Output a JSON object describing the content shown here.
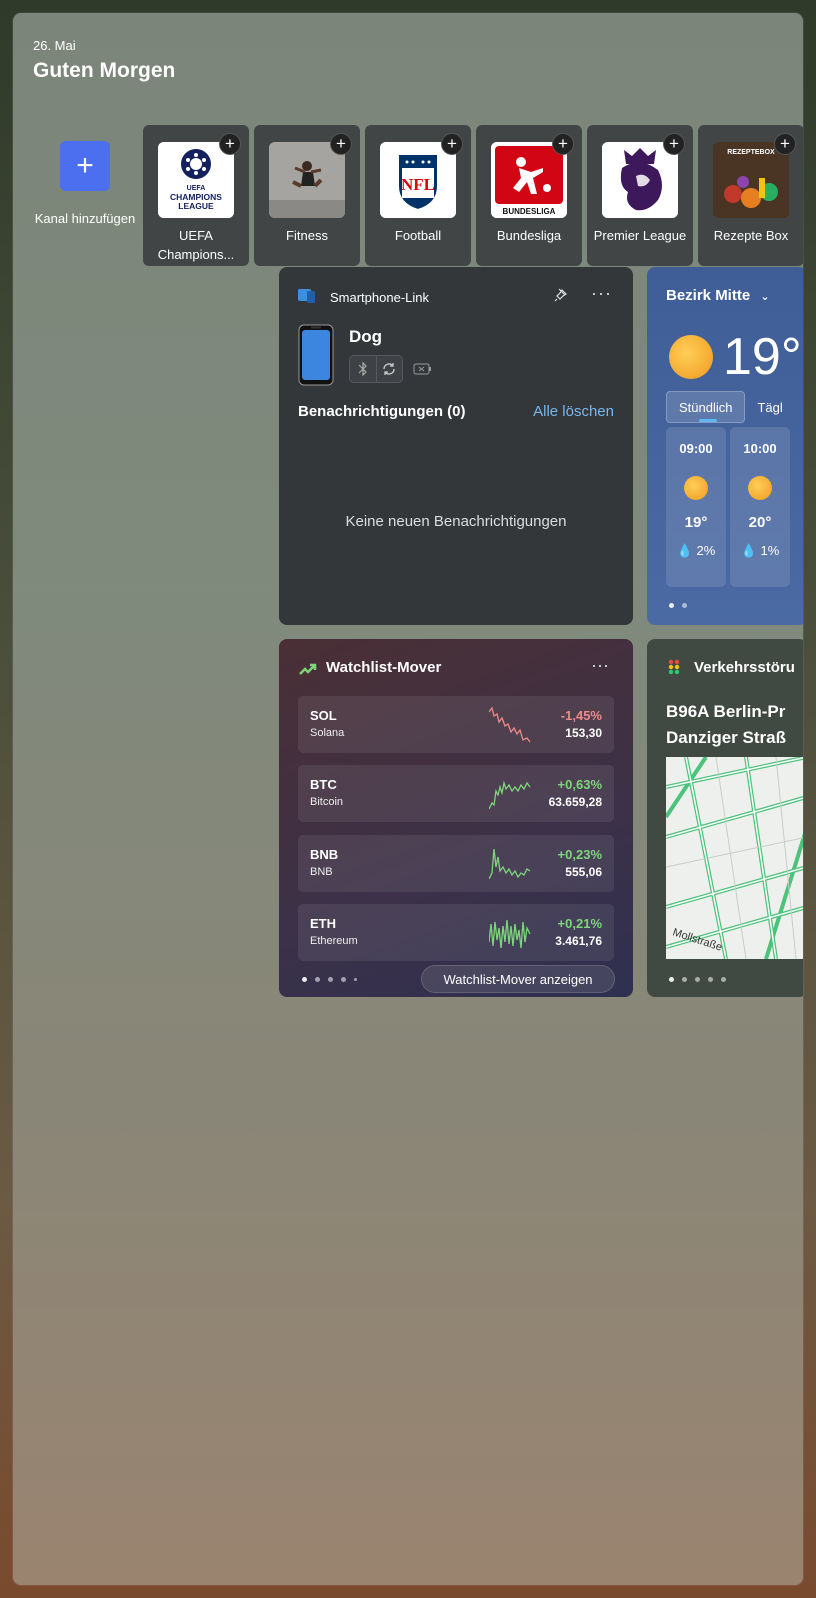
{
  "header": {
    "date": "26. Mai",
    "greeting": "Guten Morgen"
  },
  "channels": {
    "add_label": "Kanal hinzufügen",
    "items": [
      {
        "label": "UEFA Champions...",
        "logo_text": "CHAMPIONS LEAGUE",
        "logo_small": "UEFA"
      },
      {
        "label": "Fitness"
      },
      {
        "label": "Football",
        "logo_text": "NFL"
      },
      {
        "label": "Bundesliga",
        "logo_text": "BUNDESLIGA"
      },
      {
        "label": "Premier League"
      },
      {
        "label": "Rezepte Box",
        "logo_text": "REZEPTEBOX"
      }
    ]
  },
  "phone_link": {
    "title": "Smartphone-Link",
    "device": "Dog",
    "notifications_header": "Benachrichtigungen (0)",
    "clear_all": "Alle löschen",
    "empty": "Keine neuen Benachrichtigungen"
  },
  "weather": {
    "location": "Bezirk Mitte",
    "current_temp": "19°",
    "tabs": [
      "Stündlich",
      "Tägl"
    ],
    "hours": [
      {
        "time": "09:00",
        "temp": "19°",
        "precip": "2%"
      },
      {
        "time": "10:00",
        "temp": "20°",
        "precip": "1%"
      }
    ]
  },
  "watchlist": {
    "title": "Watchlist-Mover",
    "button": "Watchlist-Mover anzeigen",
    "items": [
      {
        "symbol": "SOL",
        "name": "Solana",
        "change": "-1,45%",
        "price": "153,30",
        "direction": "down"
      },
      {
        "symbol": "BTC",
        "name": "Bitcoin",
        "change": "+0,63%",
        "price": "63.659,28",
        "direction": "up"
      },
      {
        "symbol": "BNB",
        "name": "BNB",
        "change": "+0,23%",
        "price": "555,06",
        "direction": "up"
      },
      {
        "symbol": "ETH",
        "name": "Ethereum",
        "change": "+0,21%",
        "price": "3.461,76",
        "direction": "up"
      }
    ]
  },
  "traffic": {
    "title": "Verkehrsstöru",
    "headline_line1": "B96A Berlin-Pr",
    "headline_line2": "Danziger Straß",
    "map_label": "Mollstraße"
  },
  "colors": {
    "accent": "#4c6ff0",
    "link": "#78b7f0",
    "negative": "#f08a8a",
    "positive": "#7ed67a"
  }
}
